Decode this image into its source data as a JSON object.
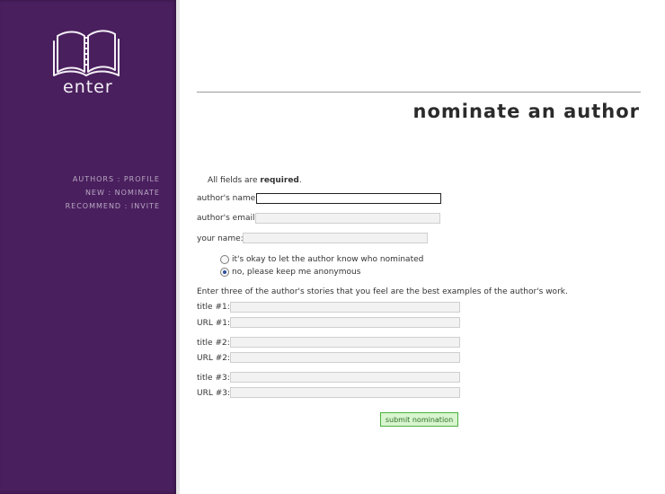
{
  "logo": {
    "text": "enter",
    "icon": "open-book-icon"
  },
  "sidebar": {
    "nav": [
      {
        "label": "AUTHORS : PROFILE"
      },
      {
        "label": "NEW : NOMINATE"
      },
      {
        "label": "RECOMMEND : INVITE"
      }
    ]
  },
  "page": {
    "title": "nominate an author"
  },
  "form": {
    "required_prefix": "All fields are ",
    "required_word": "required",
    "required_suffix": ".",
    "author_name_label": "author's name:",
    "author_email_label": "author's email:",
    "your_name_label": "your name:",
    "radio_ok_label": "it's okay to let the author know who nominated",
    "radio_anon_label": "no, please keep me anonymous",
    "radio_selected": "anonymous",
    "stories_intro": "Enter three of the author's stories that you feel are the best examples of the author's work.",
    "title1_label": "title #1:",
    "url1_label": "URL #1:",
    "title2_label": "title #2:",
    "url2_label": "URL #2:",
    "title3_label": "title #3:",
    "url3_label": "URL #3:",
    "submit_label": "submit nomination"
  },
  "colors": {
    "sidebar_bg": "#4a1f5e",
    "sidebar_text": "#b7a8c2",
    "submit_bg": "#d8f5cf",
    "submit_border": "#48b23b"
  }
}
